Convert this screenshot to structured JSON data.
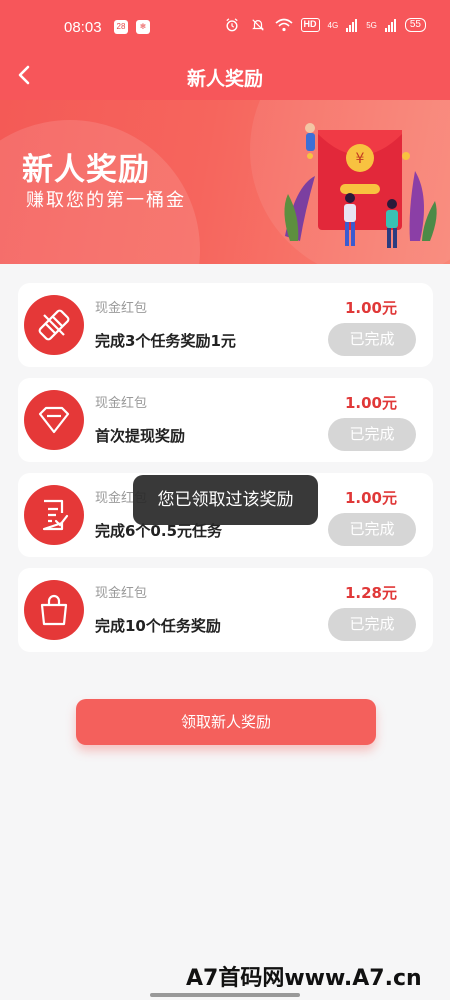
{
  "status_bar": {
    "time": "08:03",
    "mini_badge_1": "28",
    "mini_badge_2": "❄",
    "hd": "HD",
    "signal_1": "4G",
    "signal_2": "5G",
    "battery": "55"
  },
  "header": {
    "title": "新人奖励"
  },
  "banner": {
    "title": "新人奖励",
    "subtitle": "赚取您的第一桶金"
  },
  "rewards": [
    {
      "tag": "现金红包",
      "name": "完成3个任务奖励1元",
      "amount": "1.00元",
      "status": "已完成",
      "icon": "ticket-icon"
    },
    {
      "tag": "现金红包",
      "name": "首次提现奖励",
      "amount": "1.00元",
      "status": "已完成",
      "icon": "diamond-icon"
    },
    {
      "tag": "现金红包",
      "name": "完成6个0.5元任务",
      "amount": "1.00元",
      "status": "已完成",
      "icon": "checklist-icon"
    },
    {
      "tag": "现金红包",
      "name": "完成10个任务奖励",
      "amount": "1.28元",
      "status": "已完成",
      "icon": "shopping-bag-icon"
    }
  ],
  "toast": "您已领取过该奖励",
  "main_button": "领取新人奖励",
  "watermark": "A7首码网www.A7.cn",
  "colors": {
    "brand_red": "#f7565a",
    "amount_red": "#e03838",
    "done_gray": "#d6d6d6"
  }
}
